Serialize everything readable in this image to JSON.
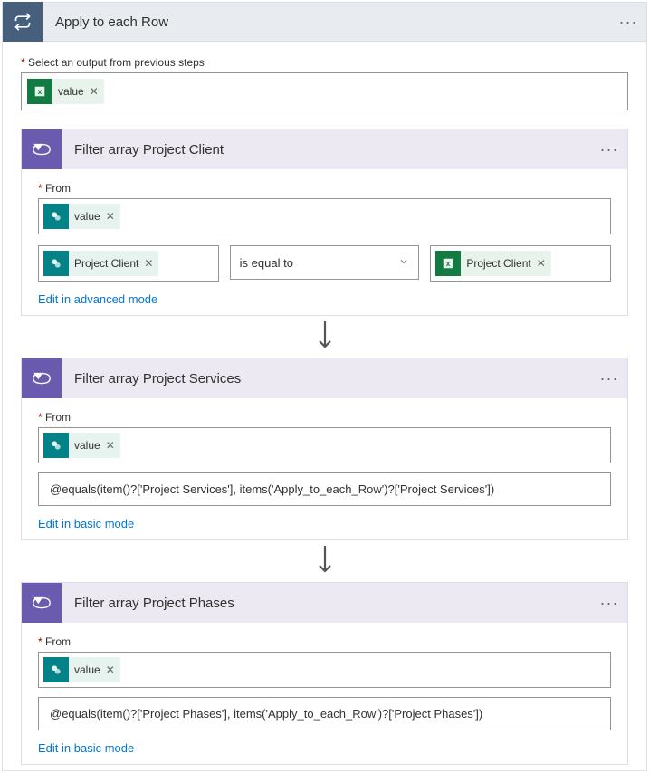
{
  "header": {
    "title": "Apply to each Row"
  },
  "outputSelect": {
    "label": "Select an output from previous steps",
    "token": {
      "label": "value",
      "source": "excel"
    }
  },
  "filter1": {
    "title": "Filter array Project Client",
    "fromLabel": "From",
    "fromToken": {
      "label": "value",
      "source": "sp"
    },
    "leftToken": {
      "label": "Project Client",
      "source": "sp"
    },
    "operator": "is equal to",
    "rightToken": {
      "label": "Project Client",
      "source": "excel"
    },
    "link": "Edit in advanced mode"
  },
  "filter2": {
    "title": "Filter array Project Services",
    "fromLabel": "From",
    "fromToken": {
      "label": "value",
      "source": "sp"
    },
    "expression": "@equals(item()?['Project Services'], items('Apply_to_each_Row')?['Project Services'])",
    "link": "Edit in basic mode"
  },
  "filter3": {
    "title": "Filter array Project Phases",
    "fromLabel": "From",
    "fromToken": {
      "label": "value",
      "source": "sp"
    },
    "expression": "@equals(item()?['Project Phases'], items('Apply_to_each_Row')?['Project Phases'])",
    "link": "Edit in basic mode"
  }
}
